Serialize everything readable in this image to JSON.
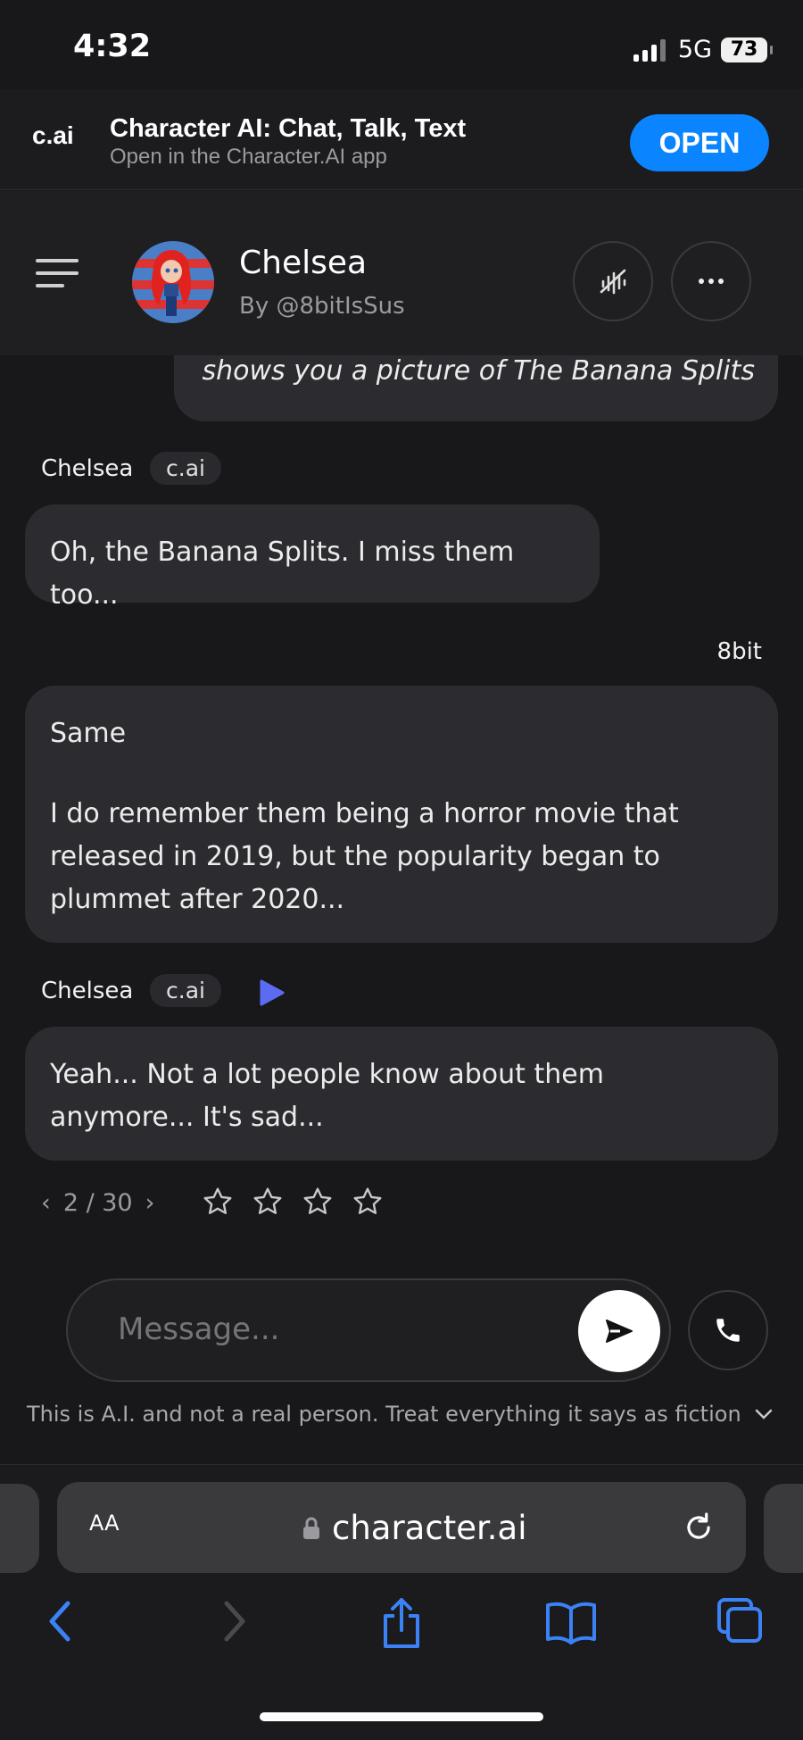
{
  "status_bar": {
    "time": "4:32",
    "network": "5G",
    "battery": "73"
  },
  "app_banner": {
    "logo": "c.ai",
    "title": "Character AI: Chat, Talk, Text",
    "subtitle": "Open in the Character.AI app",
    "open_label": "OPEN"
  },
  "header": {
    "name": "Chelsea",
    "creator": "By @8bitIsSus"
  },
  "messages": {
    "user_1": {
      "text": "shows you a picture of The Banana Splits"
    },
    "bot_1": {
      "name": "Chelsea",
      "tag": "c.ai",
      "text": "Oh, the Banana Splits. I miss them too..."
    },
    "user_2": {
      "name": "8bit",
      "line1": "Same",
      "line2": "I do remember them being a horror movie that released in 2019, but the popularity began to plummet after 2020..."
    },
    "bot_2": {
      "name": "Chelsea",
      "tag": "c.ai",
      "text": "Yeah... Not a lot people know about them anymore... It's sad..."
    }
  },
  "pager": {
    "current": "2",
    "total": "30",
    "label": "2 / 30",
    "rating": 0,
    "max_rating": 5
  },
  "composer": {
    "placeholder": "Message..."
  },
  "disclaimer": "This is A.I. and not a real person. Treat everything it says as fiction",
  "browser": {
    "text_size": "AA",
    "url": "character.ai"
  },
  "colors": {
    "accent": "#0a84ff",
    "background": "#18181b",
    "bubble": "#2c2c30",
    "play": "#5b6cf0"
  }
}
